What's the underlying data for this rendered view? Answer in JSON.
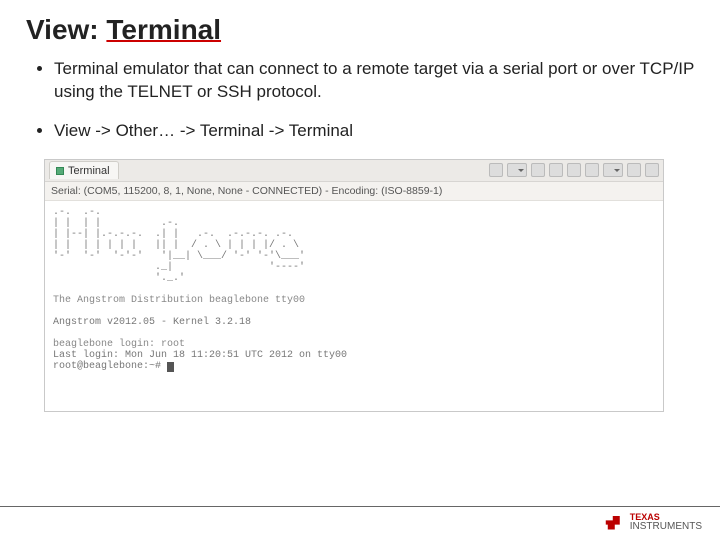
{
  "title_prefix": "View: ",
  "title_word": "Terminal",
  "bullets": [
    "Terminal emulator that can connect to a remote target via a serial port or over TCP/IP using the TELNET or SSH protocol.",
    "View -> Other… -> Terminal -> Terminal"
  ],
  "terminal": {
    "tab_label": "Terminal",
    "status": "Serial: (COM5, 115200, 8, 1, None, None - CONNECTED) - Encoding: (ISO-8859-1)",
    "ascii_art": ".-.  .-.\n| |  | |          .-.\n| |--| |.-.-.-.  .| |   .-.  .-.-.-. .-.\n| |  | | | | |   || |  / . \\ | | | |/ . \\\n'-'  '-'  '-'-'   '|__| \\___/ '-' '-'\\___'\n                 ._|                '----'\n                 '._.'",
    "dist_line": "The Angstrom Distribution beaglebone tty00",
    "kernel_line": "Angstrom v2012.05 - Kernel 3.2.18",
    "login_line1": "beaglebone login: root",
    "login_line2": "Last login: Mon Jun 18 11:20:51 UTC 2012 on tty00",
    "prompt": "root@beaglebone:~# "
  },
  "footer": {
    "brand_top": "TEXAS",
    "brand_bottom": "INSTRUMENTS"
  }
}
